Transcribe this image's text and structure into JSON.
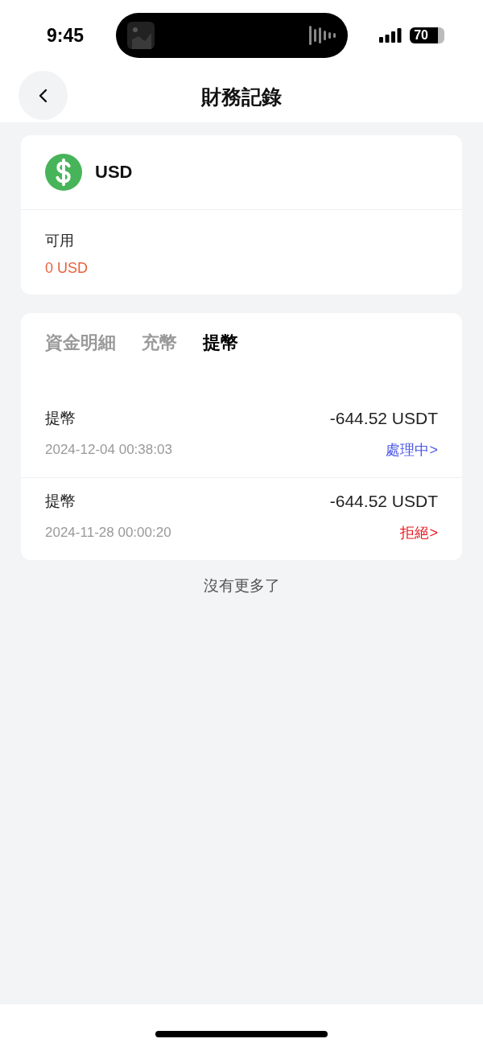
{
  "status_bar": {
    "time": "9:45",
    "battery": "70"
  },
  "header": {
    "title": "財務記錄"
  },
  "currency": {
    "name": "USD",
    "available_label": "可用",
    "available_value": "0 USD"
  },
  "tabs": [
    {
      "label": "資金明細",
      "selected": false
    },
    {
      "label": "充幣",
      "selected": false
    },
    {
      "label": "提幣",
      "selected": true
    }
  ],
  "records": [
    {
      "type": "提幣",
      "amount": "-644.52 USDT",
      "time": "2024-12-04 00:38:03",
      "status": "處理中>",
      "color": "#4b57e6"
    },
    {
      "type": "提幣",
      "amount": "-644.52 USDT",
      "time": "2024-11-28 00:00:20",
      "status": "拒絕>",
      "color": "#e5141b"
    }
  ],
  "footer_note": "沒有更多了"
}
